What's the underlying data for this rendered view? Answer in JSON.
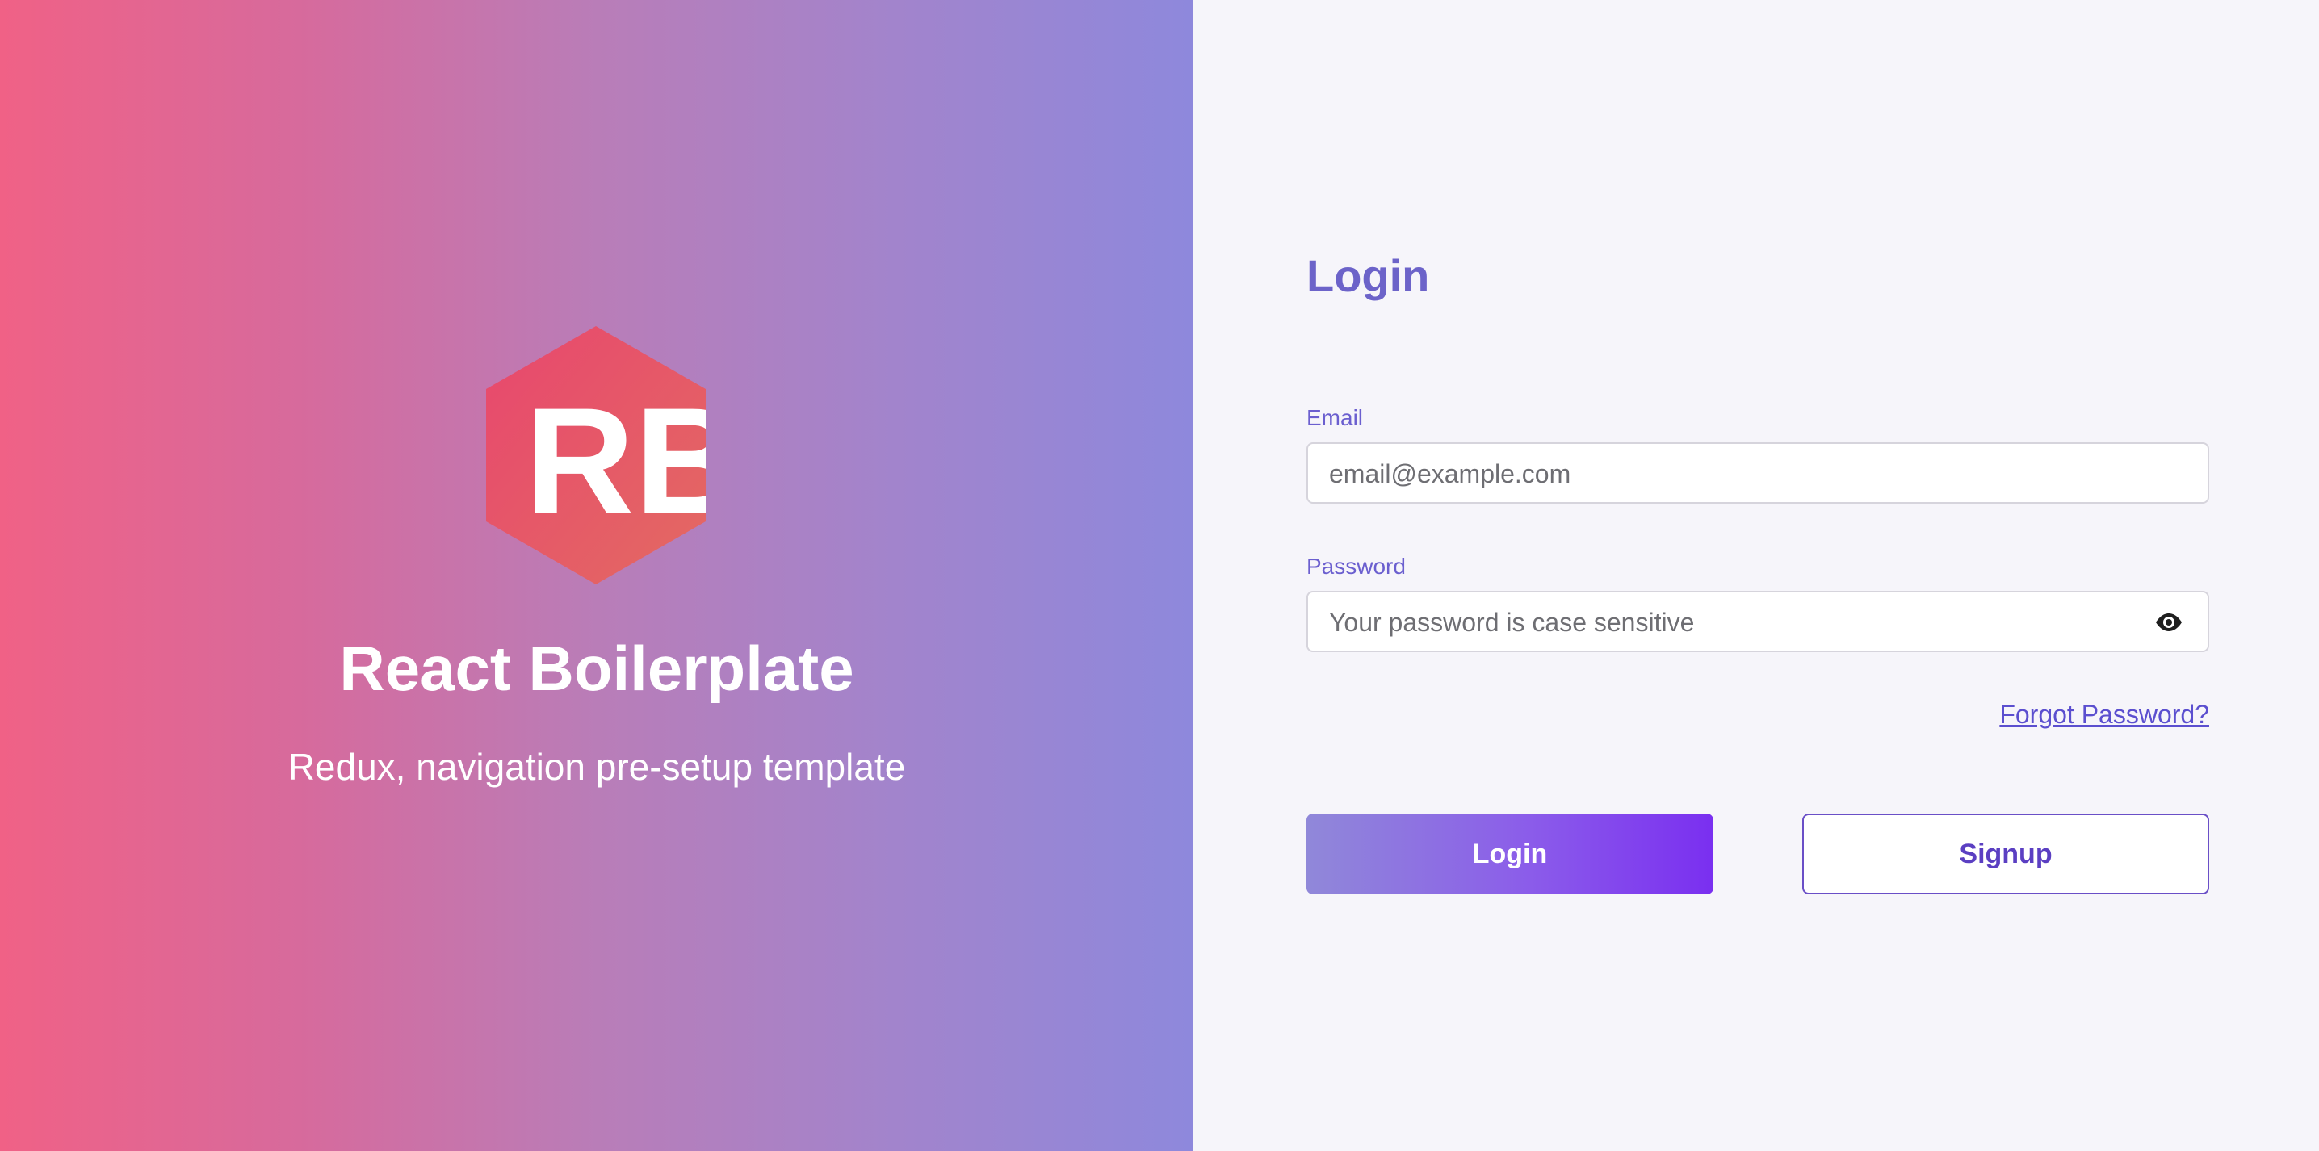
{
  "hero": {
    "logo_text": "RB",
    "title": "React Boilerplate",
    "subtitle": "Redux, navigation pre-setup template"
  },
  "form": {
    "title": "Login",
    "email": {
      "label": "Email",
      "placeholder": "email@example.com",
      "value": ""
    },
    "password": {
      "label": "Password",
      "placeholder": "Your password is case sensitive",
      "value": "",
      "toggle_icon": "eye-icon"
    },
    "forgot_password": "Forgot Password?",
    "login_button": "Login",
    "signup_button": "Signup"
  },
  "colors": {
    "accent": "#6c63c9",
    "gradient_left_start": "#f06186",
    "gradient_left_end": "#8e88dc",
    "button_gradient_end": "#7a2ff0",
    "panel_background": "#f6f5fa"
  }
}
